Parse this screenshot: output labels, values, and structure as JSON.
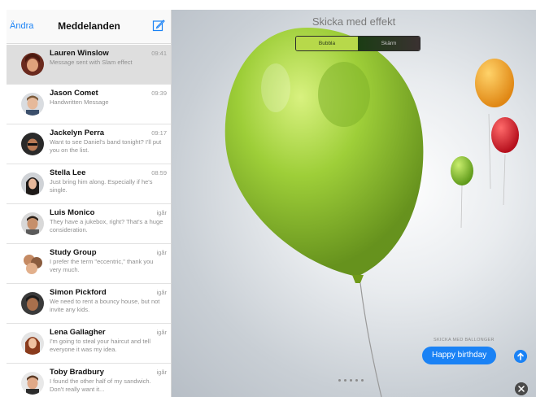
{
  "sidebar": {
    "edit_label": "Ändra",
    "title": "Meddelanden",
    "conversations": [
      {
        "name": "Lauren Winslow",
        "time": "09:41",
        "preview": "Message sent with Slam effect",
        "selected": true
      },
      {
        "name": "Jason Comet",
        "time": "09:39",
        "preview": "Handwritten Message",
        "selected": false
      },
      {
        "name": "Jackelyn Perra",
        "time": "09:17",
        "preview": "Want to see Daniel's band tonight? I'll put you on the list.",
        "selected": false
      },
      {
        "name": "Stella Lee",
        "time": "08:59",
        "preview": "Just bring him along. Especially if he's single.",
        "selected": false
      },
      {
        "name": "Luis Monico",
        "time": "igår",
        "preview": "They have a jukebox, right? That's a huge consideration.",
        "selected": false
      },
      {
        "name": "Study Group",
        "time": "igår",
        "preview": "I prefer the term \"eccentric,\" thank you very much.",
        "selected": false
      },
      {
        "name": "Simon Pickford",
        "time": "igår",
        "preview": "We need to rent a bouncy house, but not invite any kids.",
        "selected": false
      },
      {
        "name": "Lena Gallagher",
        "time": "igår",
        "preview": "I'm going to steal your haircut and tell everyone it was my idea.",
        "selected": false
      },
      {
        "name": "Toby Bradbury",
        "time": "igår",
        "preview": "I found the other half of my sandwich. Don't really want it...",
        "selected": false
      }
    ]
  },
  "main": {
    "title": "Skicka med effekt",
    "segments": [
      "Bubbla",
      "Skärm"
    ],
    "active_segment": "Bubbla",
    "bubble_caption": "SKICKA MED BALLONGER",
    "message": "Happy birthday",
    "page_dots": 5
  },
  "colors": {
    "accent": "#1a82f5",
    "balloon_green": "#9acd2f",
    "balloon_orange": "#f4a62a",
    "balloon_red": "#e01f2e"
  },
  "icons": {
    "compose": "compose-icon",
    "send": "send-arrow-icon",
    "close": "close-icon"
  }
}
